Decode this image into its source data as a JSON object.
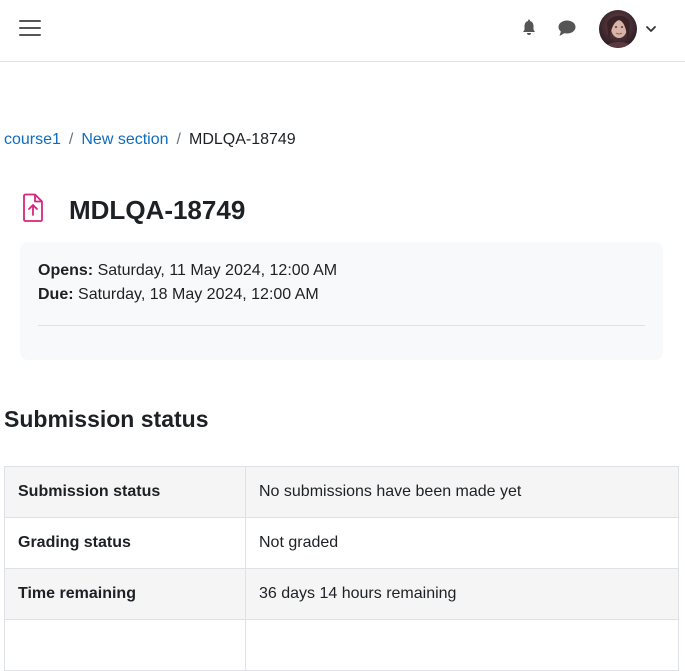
{
  "navbar": {
    "menu_icon": "hamburger-menu-icon",
    "notifications_icon": "bell-icon",
    "messages_icon": "chat-bubble-icon",
    "user_menu_icon": "chevron-down-icon",
    "accent_color": "#0f6cbf"
  },
  "breadcrumb": {
    "items": [
      "course1",
      "New section"
    ],
    "separator": "/",
    "current": "MDLQA-18749"
  },
  "page": {
    "activity_icon": "file-upload-icon",
    "activity_icon_color": "#d7267d",
    "title": "MDLQA-18749"
  },
  "dates": {
    "opens_label": "Opens:",
    "opens_value": "Saturday, 11 May 2024, 12:00 AM",
    "due_label": "Due:",
    "due_value": "Saturday, 18 May 2024, 12:00 AM"
  },
  "submission": {
    "heading": "Submission status",
    "rows": [
      {
        "label": "Submission status",
        "value": "No submissions have been made yet"
      },
      {
        "label": "Grading status",
        "value": "Not graded"
      },
      {
        "label": "Time remaining",
        "value": "36 days 14 hours remaining"
      }
    ]
  }
}
